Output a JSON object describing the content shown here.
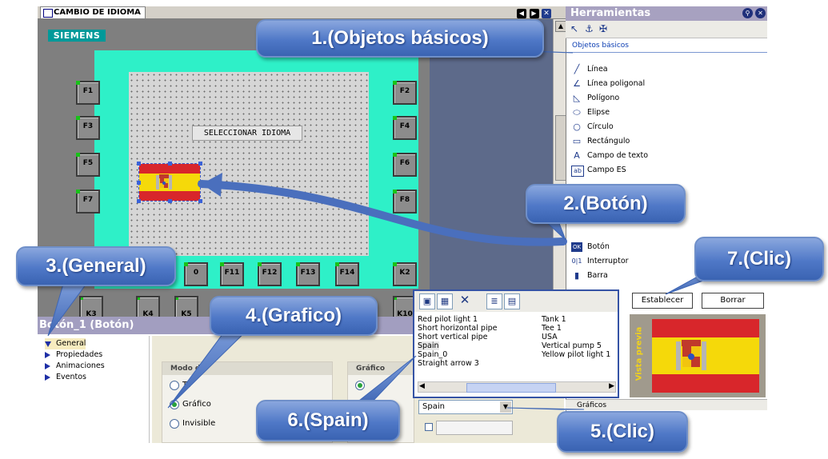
{
  "editor": {
    "tab_title": "CAMBIO DE IDIOMA",
    "brand": "SIEMENS",
    "select_label": "SELECCIONAR IDIOMA",
    "fkeys_right": [
      "F2",
      "F4",
      "F6",
      "F8"
    ],
    "fkeys_left": [
      "F1",
      "F3",
      "F5",
      "F7"
    ],
    "fkeys_bottom": [
      "0",
      "F11",
      "F12",
      "F13",
      "F14",
      "K2"
    ],
    "fkeys_bottom_partial": [
      "K3",
      "K4",
      "K5",
      "K10"
    ]
  },
  "tools": {
    "title": "Herramientas",
    "section": "Objetos básicos",
    "items": [
      {
        "label": "Línea",
        "icon": "line-icon"
      },
      {
        "label": "Línea poligonal",
        "icon": "polyline-icon"
      },
      {
        "label": "Polígono",
        "icon": "polygon-icon"
      },
      {
        "label": "Elipse",
        "icon": "ellipse-icon"
      },
      {
        "label": "Círculo",
        "icon": "circle-icon"
      },
      {
        "label": "Rectángulo",
        "icon": "rectangle-icon"
      },
      {
        "label": "Campo de texto",
        "icon": "text-field-icon"
      },
      {
        "label": "Campo ES",
        "icon": "io-field-icon"
      },
      {
        "label": "Botón",
        "icon": "button-icon"
      },
      {
        "label": "Interruptor",
        "icon": "switch-icon"
      },
      {
        "label": "Barra",
        "icon": "bar-icon"
      }
    ],
    "graficos": "Gráficos"
  },
  "properties": {
    "title": "Botón_1 (Botón)",
    "nav": [
      "General",
      "Propiedades",
      "Animaciones",
      "Eventos"
    ],
    "modo_group": "Modo de",
    "modo_options": [
      "Te",
      "Gráfico",
      "Invisible"
    ],
    "grafico_group": "Gráfico"
  },
  "popup": {
    "col1": [
      "Red pilot light 1",
      "Short horizontal pipe",
      "Short vertical pipe",
      "Spain",
      "Spain_0",
      "Straight arrow 3"
    ],
    "col2": [
      "Tank 1",
      "Tee 1",
      "USA",
      "Vertical pump 5",
      "Yellow pilot light 1"
    ],
    "combo_value": "Spain",
    "establecer": "Establecer",
    "borrar": "Borrar",
    "preview_label": "Vista previa"
  },
  "callouts": {
    "c1": "1.(Objetos básicos)",
    "c2": "2.(Botón)",
    "c3": "3.(General)",
    "c4": "4.(Grafico)",
    "c5": "5.(Clic)",
    "c6": "6.(Spain)",
    "c7": "7.(Clic)"
  },
  "colors": {
    "accent_callout": "#4f78c7",
    "frame_cyan": "#2ef0c8",
    "flag_red": "#d8262b",
    "flag_yellow": "#f5d90a",
    "brand_teal": "#009999"
  }
}
